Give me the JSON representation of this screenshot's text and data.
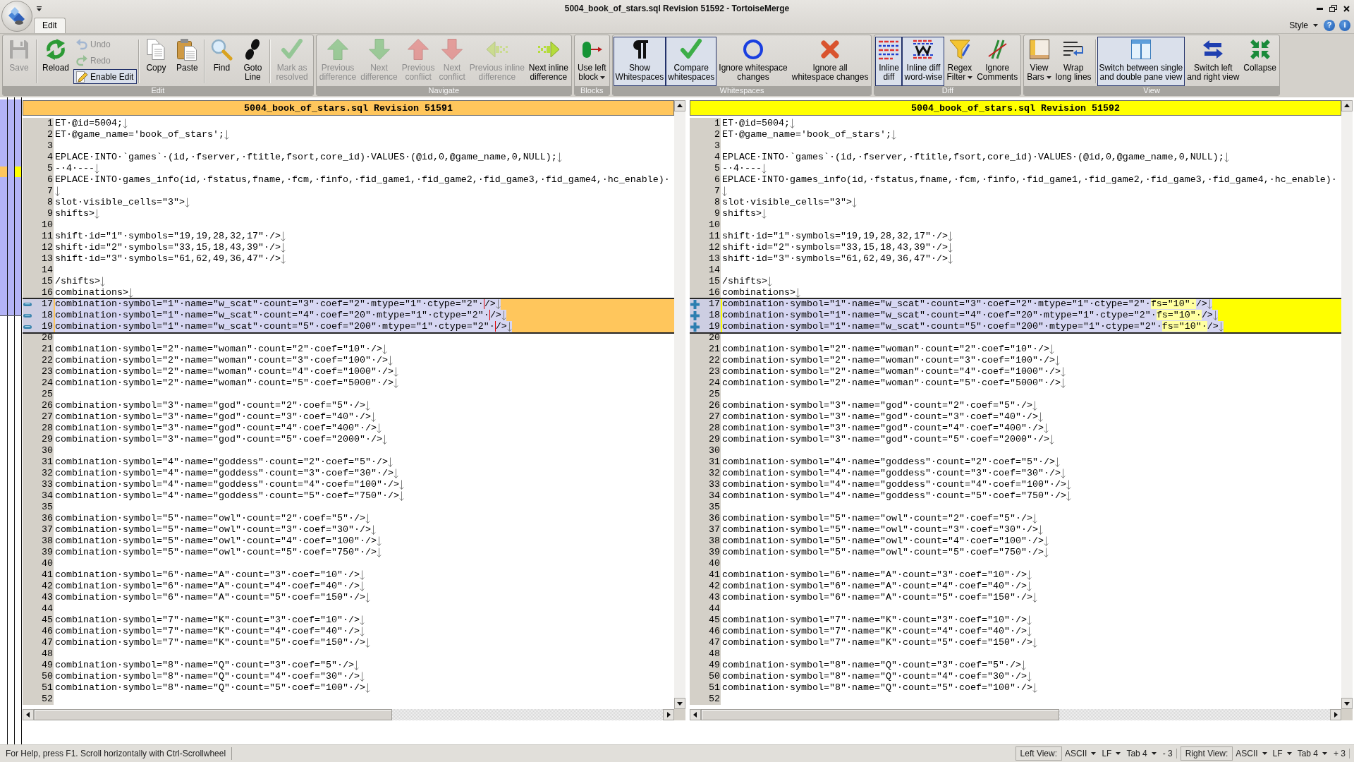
{
  "window": {
    "title": "5004_book_of_stars.sql Revision 51592 - TortoiseMerge"
  },
  "ribbon": {
    "tabs": [
      {
        "label": "Edit",
        "selected": true
      }
    ],
    "style_menu": "Style",
    "help_button": "?",
    "info_button": "i",
    "groups": [
      {
        "label": "Edit",
        "items": [
          {
            "kind": "large",
            "label": [
              "Save"
            ],
            "disabled": true,
            "checked": false,
            "dropdown": false
          },
          {
            "kind": "separator"
          },
          {
            "kind": "large",
            "label": [
              "Reload"
            ],
            "disabled": false,
            "checked": false,
            "dropdown": false
          },
          {
            "kind": "small",
            "label": [
              "Undo"
            ],
            "disabled": true,
            "checked": false,
            "dropdown": false
          },
          {
            "kind": "small",
            "label": [
              "Redo"
            ],
            "disabled": true,
            "checked": false,
            "dropdown": false
          },
          {
            "kind": "small",
            "label": [
              "Enable Edit"
            ],
            "disabled": false,
            "checked": true,
            "dropdown": false
          },
          {
            "kind": "separator"
          },
          {
            "kind": "large",
            "label": [
              "Copy"
            ],
            "disabled": false,
            "checked": false,
            "dropdown": false
          },
          {
            "kind": "large",
            "label": [
              "Paste"
            ],
            "disabled": false,
            "checked": false,
            "dropdown": false
          },
          {
            "kind": "separator"
          },
          {
            "kind": "large",
            "label": [
              "Find"
            ],
            "disabled": false,
            "checked": false,
            "dropdown": false
          },
          {
            "kind": "large",
            "label": [
              "Goto",
              "Line"
            ],
            "disabled": false,
            "checked": false,
            "dropdown": false
          },
          {
            "kind": "separator"
          },
          {
            "kind": "large",
            "label": [
              "Mark as",
              "resolved"
            ],
            "disabled": true,
            "checked": false,
            "dropdown": false
          }
        ]
      },
      {
        "label": "Navigate",
        "items": [
          {
            "kind": "large",
            "label": [
              "Previous",
              "difference"
            ],
            "disabled": true,
            "checked": false,
            "dropdown": false
          },
          {
            "kind": "large",
            "label": [
              "Next",
              "difference"
            ],
            "disabled": true,
            "checked": false,
            "dropdown": false
          },
          {
            "kind": "large",
            "label": [
              "Previous",
              "conflict"
            ],
            "disabled": true,
            "checked": false,
            "dropdown": false
          },
          {
            "kind": "large",
            "label": [
              "Next",
              "conflict"
            ],
            "disabled": true,
            "checked": false,
            "dropdown": false
          },
          {
            "kind": "large",
            "label": [
              "Previous inline",
              "difference"
            ],
            "disabled": true,
            "checked": false,
            "dropdown": false
          },
          {
            "kind": "large",
            "label": [
              "Next inline",
              "difference"
            ],
            "disabled": false,
            "checked": false,
            "dropdown": false
          }
        ]
      },
      {
        "label": "Blocks",
        "items": [
          {
            "kind": "large",
            "label": [
              "Use left",
              "block"
            ],
            "disabled": false,
            "checked": false,
            "dropdown": true
          }
        ]
      },
      {
        "label": "Whitespaces",
        "items": [
          {
            "kind": "large",
            "label": [
              "Show",
              "Whitespaces"
            ],
            "disabled": false,
            "checked": true,
            "dropdown": false
          },
          {
            "kind": "large",
            "label": [
              "Compare",
              "whitespaces"
            ],
            "disabled": false,
            "checked": true,
            "dropdown": false
          },
          {
            "kind": "large",
            "label": [
              "Ignore whitespace",
              "changes"
            ],
            "disabled": false,
            "checked": false,
            "dropdown": false
          },
          {
            "kind": "large",
            "label": [
              "Ignore all",
              "whitespace changes"
            ],
            "disabled": false,
            "checked": false,
            "dropdown": false
          }
        ]
      },
      {
        "label": "Diff",
        "items": [
          {
            "kind": "large",
            "label": [
              "Inline",
              "diff"
            ],
            "disabled": false,
            "checked": true,
            "dropdown": false
          },
          {
            "kind": "large",
            "label": [
              "Inline diff",
              "word-wise"
            ],
            "disabled": false,
            "checked": true,
            "dropdown": false
          },
          {
            "kind": "large",
            "label": [
              "Regex",
              "Filter"
            ],
            "disabled": false,
            "checked": false,
            "dropdown": true
          },
          {
            "kind": "large",
            "label": [
              "Ignore",
              "Comments"
            ],
            "disabled": false,
            "checked": false,
            "dropdown": false
          }
        ]
      },
      {
        "label": "View",
        "items": [
          {
            "kind": "large",
            "label": [
              "View",
              "Bars"
            ],
            "disabled": false,
            "checked": false,
            "dropdown": true
          },
          {
            "kind": "large",
            "label": [
              "Wrap",
              "long lines"
            ],
            "disabled": false,
            "checked": false,
            "dropdown": false
          },
          {
            "kind": "separator"
          },
          {
            "kind": "large",
            "label": [
              "Switch between single",
              "and double pane view"
            ],
            "disabled": false,
            "checked": true,
            "dropdown": false
          },
          {
            "kind": "large",
            "label": [
              "Switch left",
              "and right view"
            ],
            "disabled": false,
            "checked": false,
            "dropdown": false
          },
          {
            "kind": "large",
            "label": [
              "Collapse"
            ],
            "disabled": false,
            "checked": false,
            "dropdown": false
          }
        ]
      }
    ]
  },
  "panes": [
    {
      "header": "5004_book_of_stars.sql Revision 51591",
      "color": "#ffc65c",
      "blocks": [
        {
          "kind": "normal",
          "selected": false,
          "lines": [
            {
              "number": "1",
              "text": "ET·@id=5004;",
              "eol": true
            },
            {
              "number": "2",
              "text": "ET·@game_name='book_of_stars';",
              "eol": true
            },
            {
              "number": "3",
              "eol": false
            },
            {
              "number": "4",
              "text": "EPLACE·INTO·`games`·(id,·fserver,·ftitle,fsort,core_id)·VALUES·(@id,0,@game_name,0,NULL);",
              "eol": true
            },
            {
              "number": "5",
              "text": "-·4·---",
              "eol": true
            },
            {
              "number": "6",
              "text": "EPLACE·INTO·games_info(id,·fstatus,fname,·fcm,·finfo,·fid_game1,·fid_game2,·fid_game3,·fid_game4,·hc_enable)·",
              "eol": false
            },
            {
              "number": "7",
              "eol": true
            },
            {
              "number": "8",
              "text": "slot·visible_cells=\"3\">",
              "eol": true
            },
            {
              "number": "9",
              "text": "shifts>",
              "eol": true
            },
            {
              "number": "10",
              "eol": false
            },
            {
              "number": "11",
              "text": "shift·id=\"1\"·symbols=\"19,19,28,32,17\"·/>",
              "eol": true
            },
            {
              "number": "12",
              "text": "shift·id=\"2\"·symbols=\"33,15,18,43,39\"·/>",
              "eol": true
            },
            {
              "number": "13",
              "text": "shift·id=\"3\"·symbols=\"61,62,49,36,47\"·/>",
              "eol": true
            },
            {
              "number": "14",
              "eol": false
            },
            {
              "number": "15",
              "text": "/shifts>",
              "eol": true
            },
            {
              "number": "16",
              "text": "combinations>",
              "eol": true
            }
          ]
        },
        {
          "kind": "removed",
          "selected": true,
          "lines": [
            {
              "number": "17",
              "parts": [
                {
                  "text": "combination·symbol=\"1\"·name=\"w_scat\"·count=\"3\"·coef=\"2\"·mtype=\"1\"·ctype=\"2\"·",
                  "inserted": false,
                  "caret_before": false
                },
                {
                  "text": "/>",
                  "inserted": false,
                  "caret_before": true
                }
              ],
              "eol": true
            },
            {
              "number": "18",
              "parts": [
                {
                  "text": "combination·symbol=\"1\"·name=\"w_scat\"·count=\"4\"·coef=\"20\"·mtype=\"1\"·ctype=\"2\"·",
                  "inserted": false,
                  "caret_before": false
                },
                {
                  "text": "/>",
                  "inserted": false,
                  "caret_before": true
                }
              ],
              "eol": true
            },
            {
              "number": "19",
              "parts": [
                {
                  "text": "combination·symbol=\"1\"·name=\"w_scat\"·count=\"5\"·coef=\"200\"·mtype=\"1\"·ctype=\"2\"·",
                  "inserted": false,
                  "caret_before": false
                },
                {
                  "text": "/>",
                  "inserted": false,
                  "caret_before": true
                }
              ],
              "eol": true
            }
          ]
        },
        {
          "kind": "normal",
          "selected": false,
          "lines": [
            {
              "number": "20",
              "eol": false
            },
            {
              "number": "21",
              "text": "combination·symbol=\"2\"·name=\"woman\"·count=\"2\"·coef=\"10\"·/>",
              "eol": true
            },
            {
              "number": "22",
              "text": "combination·symbol=\"2\"·name=\"woman\"·count=\"3\"·coef=\"100\"·/>",
              "eol": true
            },
            {
              "number": "23",
              "text": "combination·symbol=\"2\"·name=\"woman\"·count=\"4\"·coef=\"1000\"·/>",
              "eol": true
            },
            {
              "number": "24",
              "text": "combination·symbol=\"2\"·name=\"woman\"·count=\"5\"·coef=\"5000\"·/>",
              "eol": true
            },
            {
              "number": "25",
              "eol": false
            },
            {
              "number": "26",
              "text": "combination·symbol=\"3\"·name=\"god\"·count=\"2\"·coef=\"5\"·/>",
              "eol": true
            },
            {
              "number": "27",
              "text": "combination·symbol=\"3\"·name=\"god\"·count=\"3\"·coef=\"40\"·/>",
              "eol": true
            },
            {
              "number": "28",
              "text": "combination·symbol=\"3\"·name=\"god\"·count=\"4\"·coef=\"400\"·/>",
              "eol": true
            },
            {
              "number": "29",
              "text": "combination·symbol=\"3\"·name=\"god\"·count=\"5\"·coef=\"2000\"·/>",
              "eol": true
            },
            {
              "number": "30",
              "eol": false
            },
            {
              "number": "31",
              "text": "combination·symbol=\"4\"·name=\"goddess\"·count=\"2\"·coef=\"5\"·/>",
              "eol": true
            },
            {
              "number": "32",
              "text": "combination·symbol=\"4\"·name=\"goddess\"·count=\"3\"·coef=\"30\"·/>",
              "eol": true
            },
            {
              "number": "33",
              "text": "combination·symbol=\"4\"·name=\"goddess\"·count=\"4\"·coef=\"100\"·/>",
              "eol": true
            },
            {
              "number": "34",
              "text": "combination·symbol=\"4\"·name=\"goddess\"·count=\"5\"·coef=\"750\"·/>",
              "eol": true
            },
            {
              "number": "35",
              "eol": false
            },
            {
              "number": "36",
              "text": "combination·symbol=\"5\"·name=\"owl\"·count=\"2\"·coef=\"5\"·/>",
              "eol": true
            },
            {
              "number": "37",
              "text": "combination·symbol=\"5\"·name=\"owl\"·count=\"3\"·coef=\"30\"·/>",
              "eol": true
            },
            {
              "number": "38",
              "text": "combination·symbol=\"5\"·name=\"owl\"·count=\"4\"·coef=\"100\"·/>",
              "eol": true
            },
            {
              "number": "39",
              "text": "combination·symbol=\"5\"·name=\"owl\"·count=\"5\"·coef=\"750\"·/>",
              "eol": true
            },
            {
              "number": "40",
              "eol": false
            },
            {
              "number": "41",
              "text": "combination·symbol=\"6\"·name=\"A\"·count=\"3\"·coef=\"10\"·/>",
              "eol": true
            },
            {
              "number": "42",
              "text": "combination·symbol=\"6\"·name=\"A\"·count=\"4\"·coef=\"40\"·/>",
              "eol": true
            },
            {
              "number": "43",
              "text": "combination·symbol=\"6\"·name=\"A\"·count=\"5\"·coef=\"150\"·/>",
              "eol": true
            },
            {
              "number": "44",
              "eol": false
            },
            {
              "number": "45",
              "text": "combination·symbol=\"7\"·name=\"K\"·count=\"3\"·coef=\"10\"·/>",
              "eol": true
            },
            {
              "number": "46",
              "text": "combination·symbol=\"7\"·name=\"K\"·count=\"4\"·coef=\"40\"·/>",
              "eol": true
            },
            {
              "number": "47",
              "text": "combination·symbol=\"7\"·name=\"K\"·count=\"5\"·coef=\"150\"·/>",
              "eol": true
            },
            {
              "number": "48",
              "eol": false
            },
            {
              "number": "49",
              "text": "combination·symbol=\"8\"·name=\"Q\"·count=\"3\"·coef=\"5\"·/>",
              "eol": true
            },
            {
              "number": "50",
              "text": "combination·symbol=\"8\"·name=\"Q\"·count=\"4\"·coef=\"30\"·/>",
              "eol": true
            },
            {
              "number": "51",
              "text": "combination·symbol=\"8\"·name=\"Q\"·count=\"5\"·coef=\"100\"·/>",
              "eol": true
            },
            {
              "number": "52",
              "eol": false
            }
          ]
        }
      ]
    },
    {
      "header": "5004_book_of_stars.sql Revision 51592",
      "color": "#ffff00",
      "blocks": [
        {
          "kind": "normal",
          "selected": false,
          "lines": [
            {
              "number": "1",
              "text": "ET·@id=5004;",
              "eol": true
            },
            {
              "number": "2",
              "text": "ET·@game_name='book_of_stars';",
              "eol": true
            },
            {
              "number": "3",
              "eol": false
            },
            {
              "number": "4",
              "text": "EPLACE·INTO·`games`·(id,·fserver,·ftitle,fsort,core_id)·VALUES·(@id,0,@game_name,0,NULL);",
              "eol": true
            },
            {
              "number": "5",
              "text": "-·4·---",
              "eol": true
            },
            {
              "number": "6",
              "text": "EPLACE·INTO·games_info(id,·fstatus,fname,·fcm,·finfo,·fid_game1,·fid_game2,·fid_game3,·fid_game4,·hc_enable)·",
              "eol": false
            },
            {
              "number": "7",
              "eol": true
            },
            {
              "number": "8",
              "text": "slot·visible_cells=\"3\">",
              "eol": true
            },
            {
              "number": "9",
              "text": "shifts>",
              "eol": true
            },
            {
              "number": "10",
              "eol": false
            },
            {
              "number": "11",
              "text": "shift·id=\"1\"·symbols=\"19,19,28,32,17\"·/>",
              "eol": true
            },
            {
              "number": "12",
              "text": "shift·id=\"2\"·symbols=\"33,15,18,43,39\"·/>",
              "eol": true
            },
            {
              "number": "13",
              "text": "shift·id=\"3\"·symbols=\"61,62,49,36,47\"·/>",
              "eol": true
            },
            {
              "number": "14",
              "eol": false
            },
            {
              "number": "15",
              "text": "/shifts>",
              "eol": true
            },
            {
              "number": "16",
              "text": "combinations>",
              "eol": true
            }
          ]
        },
        {
          "kind": "added",
          "selected": true,
          "lines": [
            {
              "number": "17",
              "parts": [
                {
                  "text": "combination·symbol=\"1\"·name=\"w_scat\"·count=\"3\"·coef=\"2\"·mtype=\"1\"·ctype=\"2\"·",
                  "inserted": false,
                  "caret_before": false
                },
                {
                  "text": "fs=\"10\"·",
                  "inserted": true,
                  "caret_before": false
                },
                {
                  "text": "/>",
                  "inserted": false,
                  "caret_before": false
                }
              ],
              "eol": true
            },
            {
              "number": "18",
              "parts": [
                {
                  "text": "combination·symbol=\"1\"·name=\"w_scat\"·count=\"4\"·coef=\"20\"·mtype=\"1\"·ctype=\"2\"·",
                  "inserted": false,
                  "caret_before": false
                },
                {
                  "text": "fs=\"10\"·",
                  "inserted": true,
                  "caret_before": false
                },
                {
                  "text": "/>",
                  "inserted": false,
                  "caret_before": false
                }
              ],
              "eol": true
            },
            {
              "number": "19",
              "parts": [
                {
                  "text": "combination·symbol=\"1\"·name=\"w_scat\"·count=\"5\"·coef=\"200\"·mtype=\"1\"·ctype=\"2\"·",
                  "inserted": false,
                  "caret_before": false
                },
                {
                  "text": "fs=\"10\"·",
                  "inserted": true,
                  "caret_before": false
                },
                {
                  "text": "/>",
                  "inserted": false,
                  "caret_before": false
                }
              ],
              "eol": true
            }
          ]
        },
        {
          "kind": "normal",
          "selected": false,
          "lines": [
            {
              "number": "20",
              "eol": false
            },
            {
              "number": "21",
              "text": "combination·symbol=\"2\"·name=\"woman\"·count=\"2\"·coef=\"10\"·/>",
              "eol": true
            },
            {
              "number": "22",
              "text": "combination·symbol=\"2\"·name=\"woman\"·count=\"3\"·coef=\"100\"·/>",
              "eol": true
            },
            {
              "number": "23",
              "text": "combination·symbol=\"2\"·name=\"woman\"·count=\"4\"·coef=\"1000\"·/>",
              "eol": true
            },
            {
              "number": "24",
              "text": "combination·symbol=\"2\"·name=\"woman\"·count=\"5\"·coef=\"5000\"·/>",
              "eol": true
            },
            {
              "number": "25",
              "eol": false
            },
            {
              "number": "26",
              "text": "combination·symbol=\"3\"·name=\"god\"·count=\"2\"·coef=\"5\"·/>",
              "eol": true
            },
            {
              "number": "27",
              "text": "combination·symbol=\"3\"·name=\"god\"·count=\"3\"·coef=\"40\"·/>",
              "eol": true
            },
            {
              "number": "28",
              "text": "combination·symbol=\"3\"·name=\"god\"·count=\"4\"·coef=\"400\"·/>",
              "eol": true
            },
            {
              "number": "29",
              "text": "combination·symbol=\"3\"·name=\"god\"·count=\"5\"·coef=\"2000\"·/>",
              "eol": true
            },
            {
              "number": "30",
              "eol": false
            },
            {
              "number": "31",
              "text": "combination·symbol=\"4\"·name=\"goddess\"·count=\"2\"·coef=\"5\"·/>",
              "eol": true
            },
            {
              "number": "32",
              "text": "combination·symbol=\"4\"·name=\"goddess\"·count=\"3\"·coef=\"30\"·/>",
              "eol": true
            },
            {
              "number": "33",
              "text": "combination·symbol=\"4\"·name=\"goddess\"·count=\"4\"·coef=\"100\"·/>",
              "eol": true
            },
            {
              "number": "34",
              "text": "combination·symbol=\"4\"·name=\"goddess\"·count=\"5\"·coef=\"750\"·/>",
              "eol": true
            },
            {
              "number": "35",
              "eol": false
            },
            {
              "number": "36",
              "text": "combination·symbol=\"5\"·name=\"owl\"·count=\"2\"·coef=\"5\"·/>",
              "eol": true
            },
            {
              "number": "37",
              "text": "combination·symbol=\"5\"·name=\"owl\"·count=\"3\"·coef=\"30\"·/>",
              "eol": true
            },
            {
              "number": "38",
              "text": "combination·symbol=\"5\"·name=\"owl\"·count=\"4\"·coef=\"100\"·/>",
              "eol": true
            },
            {
              "number": "39",
              "text": "combination·symbol=\"5\"·name=\"owl\"·count=\"5\"·coef=\"750\"·/>",
              "eol": true
            },
            {
              "number": "40",
              "eol": false
            },
            {
              "number": "41",
              "text": "combination·symbol=\"6\"·name=\"A\"·count=\"3\"·coef=\"10\"·/>",
              "eol": true
            },
            {
              "number": "42",
              "text": "combination·symbol=\"6\"·name=\"A\"·count=\"4\"·coef=\"40\"·/>",
              "eol": true
            },
            {
              "number": "43",
              "text": "combination·symbol=\"6\"·name=\"A\"·count=\"5\"·coef=\"150\"·/>",
              "eol": true
            },
            {
              "number": "44",
              "eol": false
            },
            {
              "number": "45",
              "text": "combination·symbol=\"7\"·name=\"K\"·count=\"3\"·coef=\"10\"·/>",
              "eol": true
            },
            {
              "number": "46",
              "text": "combination·symbol=\"7\"·name=\"K\"·count=\"4\"·coef=\"40\"·/>",
              "eol": true
            },
            {
              "number": "47",
              "text": "combination·symbol=\"7\"·name=\"K\"·count=\"5\"·coef=\"150\"·/>",
              "eol": true
            },
            {
              "number": "48",
              "eol": false
            },
            {
              "number": "49",
              "text": "combination·symbol=\"8\"·name=\"Q\"·count=\"3\"·coef=\"5\"·/>",
              "eol": true
            },
            {
              "number": "50",
              "text": "combination·symbol=\"8\"·name=\"Q\"·count=\"4\"·coef=\"30\"·/>",
              "eol": true
            },
            {
              "number": "51",
              "text": "combination·symbol=\"8\"·name=\"Q\"·count=\"5\"·coef=\"100\"·/>",
              "eol": true
            },
            {
              "number": "52",
              "eol": false
            }
          ]
        }
      ]
    }
  ],
  "status_bar": {
    "help_text": "For Help, press F1. Scroll horizontally with Ctrl-Scrollwheel",
    "views": [
      {
        "label": "Left View:",
        "encoding": "ASCII",
        "line_ending": "LF",
        "tab_size": "Tab 4",
        "changes": "- 3"
      },
      {
        "label": "Right View:",
        "encoding": "ASCII",
        "line_ending": "LF",
        "tab_size": "Tab 4",
        "changes": "+ 3"
      }
    ]
  }
}
